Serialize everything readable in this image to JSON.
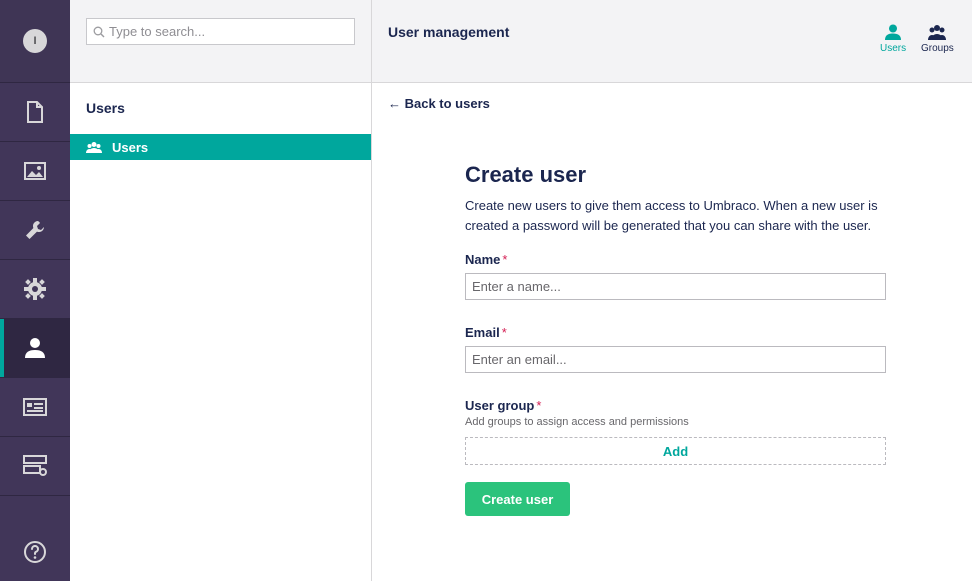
{
  "user": {
    "avatar_initial": "I"
  },
  "rail": {
    "items": [
      {
        "name": "content",
        "icon": "document-icon"
      },
      {
        "name": "media",
        "icon": "image-icon"
      },
      {
        "name": "settings",
        "icon": "wrench-icon"
      },
      {
        "name": "packages",
        "icon": "gear-icon"
      },
      {
        "name": "users",
        "icon": "user-icon",
        "active": true
      },
      {
        "name": "members",
        "icon": "id-card-icon"
      },
      {
        "name": "forms",
        "icon": "server-icon"
      }
    ],
    "help_icon": "help-icon"
  },
  "tree": {
    "search_placeholder": "Type to search...",
    "title": "Users",
    "items": [
      {
        "label": "Users",
        "icon": "users-group-icon",
        "active": true
      }
    ]
  },
  "header": {
    "title": "User management",
    "tabs": [
      {
        "label": "Users",
        "icon": "user-icon",
        "active": true
      },
      {
        "label": "Groups",
        "icon": "users-group-icon"
      }
    ]
  },
  "main": {
    "back_label": "← Back to users",
    "heading": "Create user",
    "description": "Create new users to give them access to Umbraco. When a new user is created a password will be generated that you can share with the user.",
    "name_field": {
      "label": "Name",
      "required_mark": "*",
      "placeholder": "Enter a name...",
      "value": ""
    },
    "email_field": {
      "label": "Email",
      "required_mark": "*",
      "placeholder": "Enter an email...",
      "value": ""
    },
    "group_field": {
      "label": "User group",
      "required_mark": "*",
      "description": "Add groups to assign access and permissions",
      "add_label": "Add"
    },
    "submit_label": "Create user"
  },
  "colors": {
    "accent": "#00a79d",
    "create_button": "#2bc37c",
    "rail": "#413659",
    "required": "#d42054"
  }
}
